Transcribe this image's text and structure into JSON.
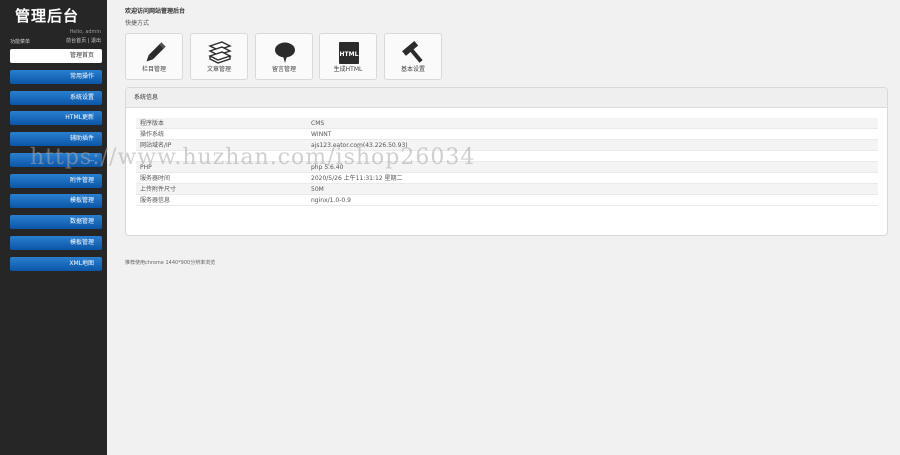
{
  "sidebar": {
    "logo": "管理后台",
    "hello": "Hello, admin",
    "menu_title": "功能菜单",
    "links": {
      "home": "前台首页",
      "sep": "|",
      "logout": "退出"
    },
    "items": [
      {
        "label": "管理首页"
      },
      {
        "label": "常用操作"
      },
      {
        "label": "系统设置"
      },
      {
        "label": "HTML更新"
      },
      {
        "label": "辅助插件"
      },
      {
        "label": "..."
      },
      {
        "label": "附件管理"
      },
      {
        "label": "模板管理"
      },
      {
        "label": "数据管理"
      },
      {
        "label": "模板管理"
      },
      {
        "label": "XML地图"
      }
    ]
  },
  "main": {
    "welcome": "欢迎访问网站管理后台",
    "shortcut_title": "快捷方式",
    "tiles": [
      {
        "label": "栏目管理",
        "icon": "pencil-icon"
      },
      {
        "label": "文章管理",
        "icon": "documents-icon"
      },
      {
        "label": "留言管理",
        "icon": "speech-bubble-icon"
      },
      {
        "label": "生成HTML",
        "icon": "html-file-icon"
      },
      {
        "label": "基本设置",
        "icon": "hammer-icon"
      }
    ],
    "panel_title": "系统信息",
    "info": [
      {
        "key": "程序版本",
        "value": "CMS"
      },
      {
        "key": "操作系统",
        "value": "WINNT"
      },
      {
        "key": "网站域名/IP",
        "value": "ajs123.eator.com(43.226.50.93)"
      },
      {
        "key": "",
        "value": ""
      },
      {
        "key": "PHP",
        "value": "php 5.6.40"
      },
      {
        "key": "服务器时间",
        "value": "2020/5/26 上午11:31:12 星期二"
      },
      {
        "key": "上传附件尺寸",
        "value": "50M"
      },
      {
        "key": "服务器信息",
        "value": "nginx/1.0-0.9"
      }
    ],
    "footer_note": "推荐使用chrome 1440*900分辨率浏览"
  },
  "watermark": "https://www.huzhan.com/ishop26034"
}
